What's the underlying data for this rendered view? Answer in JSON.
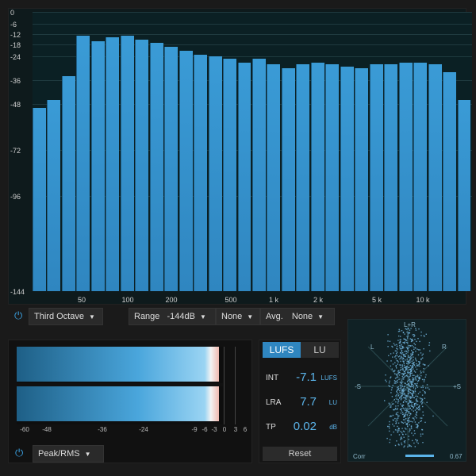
{
  "spectrum": {
    "y_labels": [
      "0",
      "-6",
      "-12",
      "-18",
      "-24",
      "-36",
      "-48",
      "-72",
      "-96",
      "-144"
    ],
    "x_labels": [
      "50",
      "100",
      "200",
      "500",
      "1 k",
      "2 k",
      "5 k",
      "10 k"
    ],
    "bars_db": [
      -50,
      -46,
      -34,
      -13,
      -16,
      -14,
      -13,
      -15,
      -17,
      -19,
      -21,
      -23,
      -24,
      -25,
      -27,
      -25,
      -28,
      -30,
      -28,
      -27,
      -28,
      -29,
      -30,
      -28,
      -28,
      -27,
      -27,
      -28,
      -32,
      -46
    ]
  },
  "controls": {
    "resolution": "Third Octave",
    "range_label": "Range",
    "range_value": "-144dB",
    "none_1": "None",
    "avg_label": "Avg.",
    "avg_value": "None"
  },
  "meter": {
    "scale": [
      "-60",
      "-48",
      "-36",
      "-24",
      "-9",
      "-6",
      "-3",
      "0",
      "3",
      "6"
    ],
    "mode": "Peak/RMS"
  },
  "loudness": {
    "tab_lufs": "LUFS",
    "tab_lu": "LU",
    "rows": [
      {
        "name": "INT",
        "value": "-7.1",
        "unit": "LUFS"
      },
      {
        "name": "LRA",
        "value": "7.7",
        "unit": "LU"
      },
      {
        "name": "TP",
        "value": "0.02",
        "unit": "dB"
      }
    ],
    "reset": "Reset"
  },
  "gonio": {
    "top": "L+R",
    "left": "-S",
    "right": "+S",
    "tl": "L",
    "tr": "R",
    "corr_label": "Corr",
    "corr_value": "0.67",
    "correlation": 0.67
  },
  "colors": {
    "accent": "#2f86c0",
    "bar": "#3a9bd6"
  }
}
